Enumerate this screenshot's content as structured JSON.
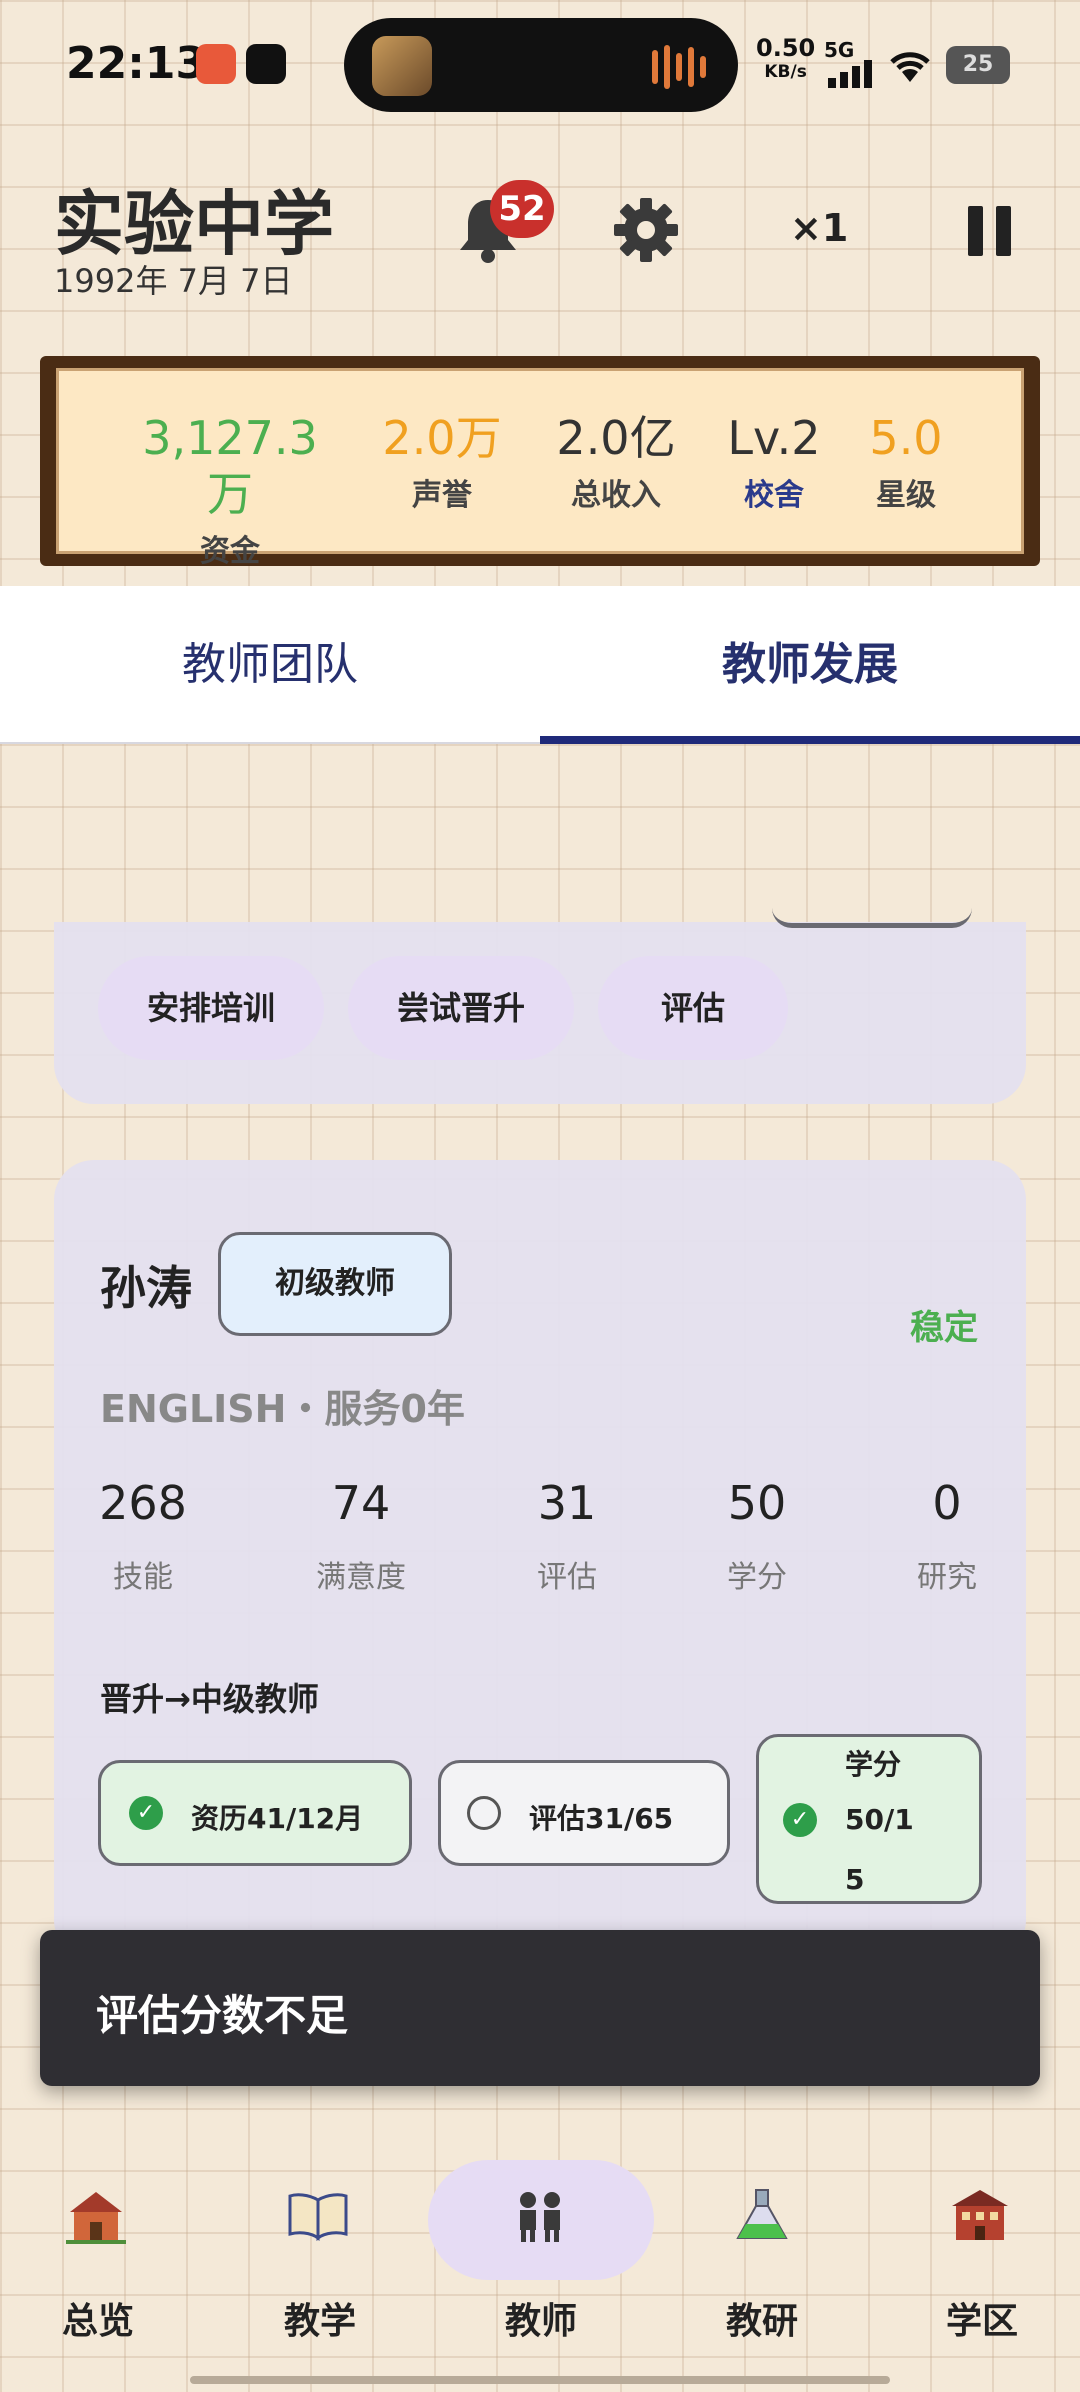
{
  "status_bar": {
    "time": "22:13",
    "net_speed_value": "0.50",
    "net_speed_unit": "KB/s",
    "network": "5G",
    "battery": "25"
  },
  "header": {
    "school_name": "实验中学",
    "date": "1992年 7月 7日",
    "notification_count": "52",
    "speed_label": "×1"
  },
  "stats": [
    {
      "value": "3,127.3万",
      "label": "资金",
      "value_color": "#4caf50",
      "label_color": "#444444"
    },
    {
      "value": "2.0万",
      "label": "声誉",
      "value_color": "#f0a020",
      "label_color": "#444444"
    },
    {
      "value": "2.0亿",
      "label": "总收入",
      "value_color": "#333333",
      "label_color": "#444444"
    },
    {
      "value": "Lv.2",
      "label": "校舍",
      "value_color": "#333333",
      "label_color": "#2a3a8c"
    },
    {
      "value": "5.0",
      "label": "星级",
      "value_color": "#f0a020",
      "label_color": "#444444"
    }
  ],
  "tabs": [
    {
      "label": "教师团队",
      "active": false
    },
    {
      "label": "教师发展",
      "active": true
    }
  ],
  "prev_card_actions": [
    "安排培训",
    "尝试晋升",
    "评估"
  ],
  "teacher": {
    "name": "孙涛",
    "rank": "初级教师",
    "status": "稳定",
    "subject_line": "ENGLISH・服务0年",
    "metrics": [
      {
        "value": "268",
        "label": "技能"
      },
      {
        "value": "74",
        "label": "满意度"
      },
      {
        "value": "31",
        "label": "评估"
      },
      {
        "value": "50",
        "label": "学分"
      },
      {
        "value": "0",
        "label": "研究"
      }
    ],
    "promotion_title": "晋升→中级教师",
    "requirements": [
      {
        "text": "资历41/12月",
        "met": true
      },
      {
        "text": "评估31/65",
        "met": false
      },
      {
        "text_lines": [
          "学分",
          "50/1",
          "5"
        ],
        "met": true
      }
    ]
  },
  "toast": "评估分数不足",
  "bottom_nav": [
    {
      "label": "总览",
      "icon": "school-house-icon",
      "active": false
    },
    {
      "label": "教学",
      "icon": "open-book-icon",
      "active": false
    },
    {
      "label": "教师",
      "icon": "teachers-icon",
      "active": true
    },
    {
      "label": "教研",
      "icon": "flask-icon",
      "active": false
    },
    {
      "label": "学区",
      "icon": "campus-building-icon",
      "active": false
    }
  ]
}
